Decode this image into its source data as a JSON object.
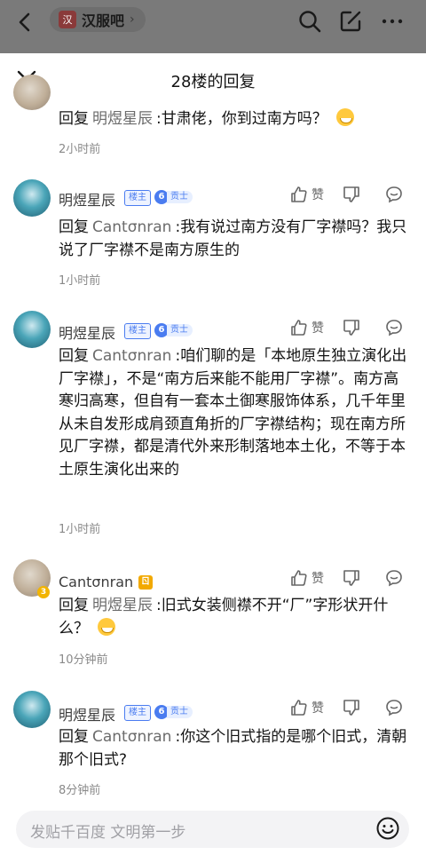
{
  "topbar": {
    "forum_logo": "汉",
    "forum_name": "汉服吧",
    "chevron": "›"
  },
  "sheet": {
    "title": "28楼的回复"
  },
  "labels": {
    "reply_prefix": "回复",
    "owner_tag": "楼主",
    "level_label": "贡士",
    "like": "赞"
  },
  "replies": [
    {
      "user": "",
      "reply_to": "明煜星辰",
      "text": ":甘肃佬，你到过南方吗？",
      "has_emoji": true,
      "time": "2小时前"
    },
    {
      "user": "明煜星辰",
      "is_owner": true,
      "level": "6",
      "reply_to": "Cantσnran",
      "text": ":我有说过南方没有厂字襟吗？我只说了厂字襟不是南方原生的",
      "time": "1小时前"
    },
    {
      "user": "明煜星辰",
      "is_owner": true,
      "level": "6",
      "reply_to": "Cantσnran",
      "text": ":咱们聊的是「本地原生独立演化出厂字襟」，不是“南方后来能不能用厂字襟”。南方高寒归高寒，但自有一套本土御寒服饰体系，几千年里从未自发形成肩颈直角折的厂字襟结构；现在南方所见厂字襟，都是清代外来形制落地本土化，不等于本土原生演化出来的",
      "time": "1小时前"
    },
    {
      "user": "Cantσnran",
      "avatar_level": "3",
      "vip_icon": "ㄖ",
      "reply_to": "明煜星辰",
      "text": ":旧式女装侧襟不开“厂”字形状开什么？",
      "has_emoji": true,
      "time": "10分钟前"
    },
    {
      "user": "明煜星辰",
      "is_owner": true,
      "level": "6",
      "reply_to": "Cantσnran",
      "text": ":你这个旧式指的是哪个旧式，清朝那个旧式?",
      "time": "8分钟前"
    }
  ],
  "input": {
    "placeholder": "发贴千百度 文明第一步"
  },
  "icons": [
    "back-icon",
    "search-icon",
    "edit-icon",
    "more-icon",
    "close-icon",
    "like-icon",
    "dislike-icon",
    "comment-icon",
    "emoji-icon"
  ],
  "colors": {
    "accent": "#4a7cf0",
    "vip": "#f2a900",
    "topbar": "#7a7a7a"
  }
}
